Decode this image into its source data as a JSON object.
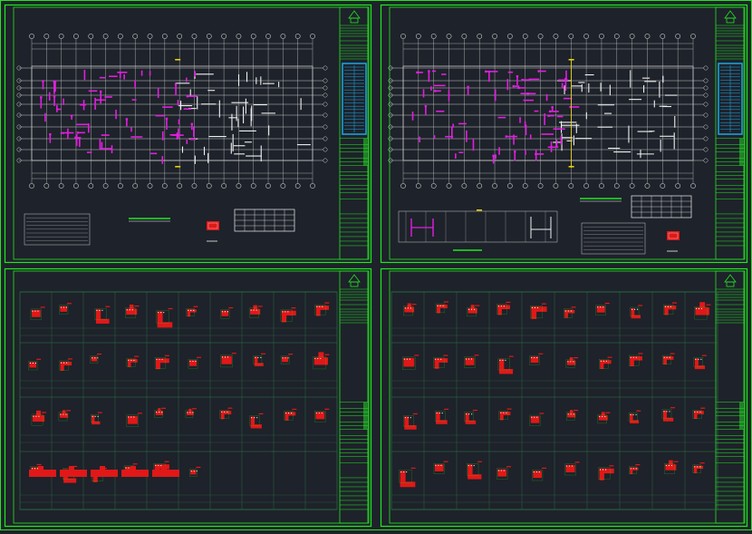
{
  "colors": {
    "background": "#1e222a",
    "sheet_border": "#22e622",
    "grid_line": "#c8c8c8",
    "column_magenta": "#e21ee2",
    "wall_white": "#f0f0f0",
    "rebar_red": "#e01818",
    "highlight_yellow": "#e8d000",
    "table_cyan": "#18a8e8",
    "table_green": "#2a7a4a"
  },
  "sheets": [
    {
      "id": "top-left",
      "type": "floor-plan",
      "variant": "A"
    },
    {
      "id": "top-right",
      "type": "floor-plan",
      "variant": "B"
    },
    {
      "id": "bottom-left",
      "type": "column-detail-table",
      "rows": 4
    },
    {
      "id": "bottom-right",
      "type": "column-detail-table",
      "rows": 4
    }
  ],
  "title_block": {
    "logo_icon": "company-logo-icon"
  }
}
